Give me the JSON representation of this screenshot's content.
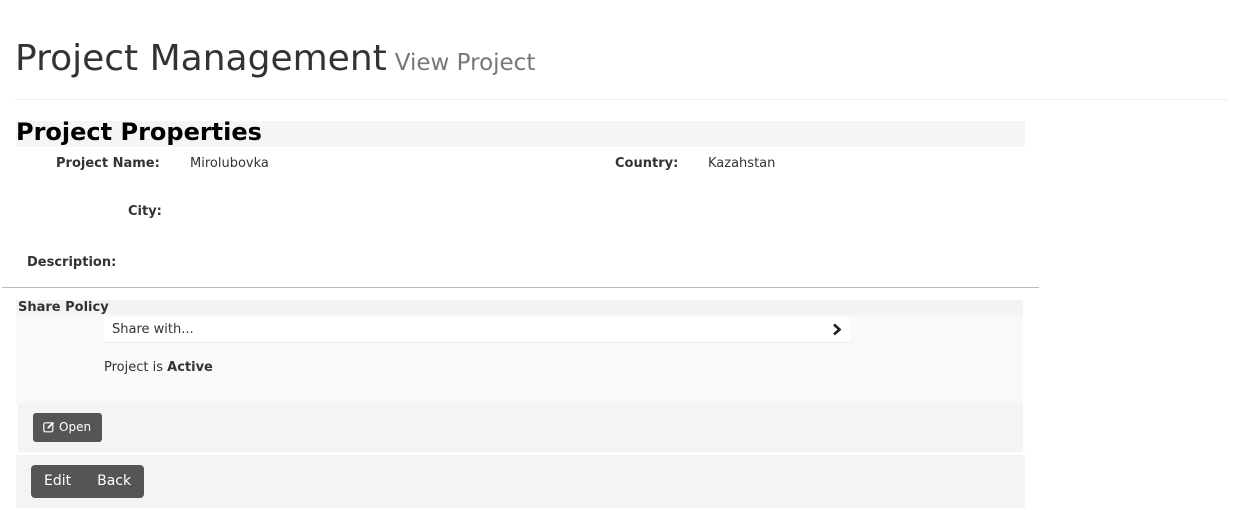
{
  "header": {
    "title": "Project Management",
    "subtitle": "View Project"
  },
  "properties": {
    "section_title": "Project Properties",
    "project_name": {
      "label": "Project Name:",
      "value": "Mirolubovka"
    },
    "country": {
      "label": "Country:",
      "value": "Kazahstan"
    },
    "city": {
      "label": "City:",
      "value": ""
    },
    "description": {
      "label": "Description:",
      "value": ""
    }
  },
  "share_policy": {
    "title": "Share Policy",
    "share_with_label": "Share with...",
    "share_icon": "chevron-right-icon",
    "status_prefix": "Project is",
    "status_value": "Active"
  },
  "open_panel": {
    "open_label": "Open",
    "open_icon": "edit-icon"
  },
  "actions": {
    "edit_label": "Edit",
    "back_label": "Back"
  },
  "colors": {
    "button_bg": "#555555",
    "panel_bg": "#f4f4f4",
    "subtitle": "#777777"
  }
}
